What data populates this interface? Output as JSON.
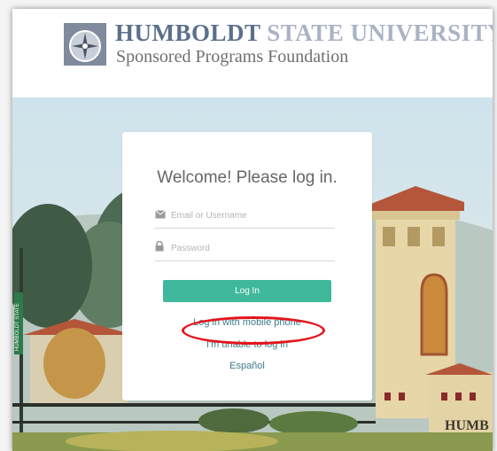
{
  "header": {
    "title_primary": "HUMBOLDT",
    "title_secondary": "STATE UNIVERSITY",
    "subtitle": "Sponsored Programs Foundation",
    "logo_icon": "compass-seal-icon"
  },
  "login": {
    "heading": "Welcome! Please log in.",
    "username": {
      "placeholder": "Email or Username",
      "icon": "envelope-icon"
    },
    "password": {
      "placeholder": "Password",
      "icon": "lock-icon"
    },
    "submit_label": "Log In",
    "links": {
      "mobile_phone": "Log in with mobile phone",
      "unable": "I'm unable to log in",
      "language": "Español"
    }
  },
  "background_sign": {
    "street_sign": "HUMBOLDT STATE",
    "building_sign": "HUMB"
  },
  "colors": {
    "accent": "#3fb89c",
    "link": "#3d7d89",
    "title": "#5b6f8c",
    "annotation": "#e3151c"
  }
}
